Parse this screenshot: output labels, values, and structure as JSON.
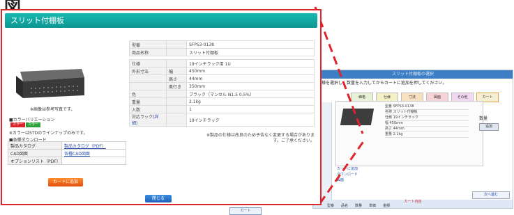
{
  "heading": "図",
  "dialog": {
    "title": "スリット付棚板",
    "image_caption": "※画像は参考写真です。",
    "color_section": {
      "title": "■カラーバリエーション",
      "badges": [
        {
          "label": "カラー",
          "color": "#d9242b"
        },
        {
          "label": "カラー",
          "color": "#2ea13a"
        }
      ],
      "note": "※カラーはSTDのラインナップのみです。"
    },
    "download_section": {
      "title": "■各種ダウンロード",
      "rows": [
        {
          "label": "製品カタログ",
          "value": "製品カタログ（PDF）"
        },
        {
          "label": "CAD図面",
          "value": "各種CAD図面"
        },
        {
          "label": "オプションリスト（PDF）",
          "value": ""
        }
      ]
    },
    "add_button": "カートに追加",
    "close_button": "閉じる",
    "specs": {
      "rows": [
        {
          "key": "型番",
          "sub": "",
          "value": "SFPS3-0138"
        },
        {
          "key": "商品名称",
          "sub": "",
          "value": "スリット付棚板"
        },
        {
          "gap": true
        },
        {
          "key": "仕様",
          "sub": "",
          "value": "19インチラック用 1U"
        },
        {
          "key": "外形寸法",
          "sub": "幅",
          "value": "450mm"
        },
        {
          "key": "",
          "sub": "高さ",
          "value": "44mm"
        },
        {
          "key": "",
          "sub": "奥行き",
          "value": "350mm"
        },
        {
          "key": "色",
          "sub": "",
          "value": "ブラック（マンセル N1.5 0.5%）"
        },
        {
          "key": "重量",
          "sub": "",
          "value": "2.1kg"
        },
        {
          "key": "入数",
          "sub": "",
          "value": "1"
        },
        {
          "key": "対応ラック",
          "link": "詳細",
          "value": "19インチラック"
        }
      ],
      "note": "※製品の仕様は改良のため予告なく変更する場合があります。ご了承ください。"
    }
  },
  "bg_window": {
    "title": "スリット付棚板の選択",
    "instruction": "仕様を選択し、数量を入力してからカートに追加を押してください。",
    "tabs": [
      "価格",
      "仕様",
      "寸法",
      "図面",
      "その他",
      "カート"
    ],
    "spec_lines": [
      "型番 SFPS3-0138",
      "名称 スリット付棚板",
      "仕様 19インチラック",
      "幅 450mm",
      "高さ 44mm",
      "重量 2.1kg"
    ],
    "cart_label": "数量",
    "cart_button": "追加",
    "links": [
      "カートに追加",
      "ダウンロード",
      "図面"
    ],
    "next_button": "次へ進む",
    "table_header": "カート内容",
    "table_row": [
      "型番",
      "品名",
      "数量",
      "単価",
      "金額"
    ],
    "bottom_tab": "カート"
  }
}
